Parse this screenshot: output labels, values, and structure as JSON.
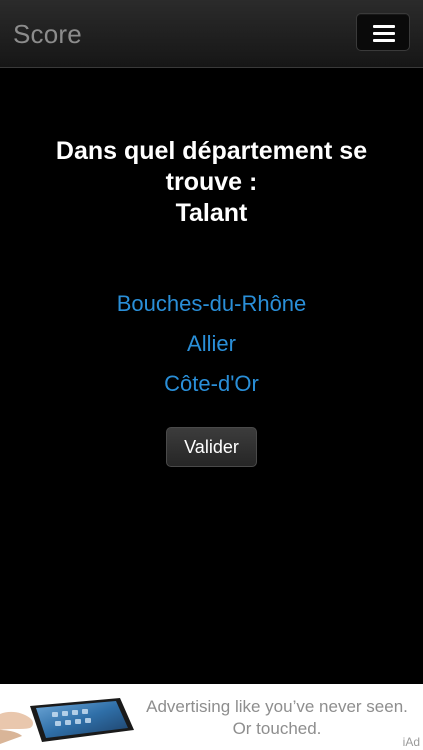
{
  "header": {
    "title": "Score",
    "menu_icon": "hamburger-menu-icon"
  },
  "question": {
    "line1": "Dans quel département se trouve :",
    "line2": "Talant"
  },
  "answers": [
    {
      "label": "Bouches-du-Rhône"
    },
    {
      "label": "Allier"
    },
    {
      "label": "Côte-d'Or"
    }
  ],
  "validate_label": "Valider",
  "ad": {
    "line1": "Advertising like you’ve never seen.",
    "line2": "Or touched.",
    "tag": "iAd"
  },
  "colors": {
    "answer_link": "#2a8fd8",
    "header_title": "#8c8c8c",
    "background": "#000000"
  }
}
